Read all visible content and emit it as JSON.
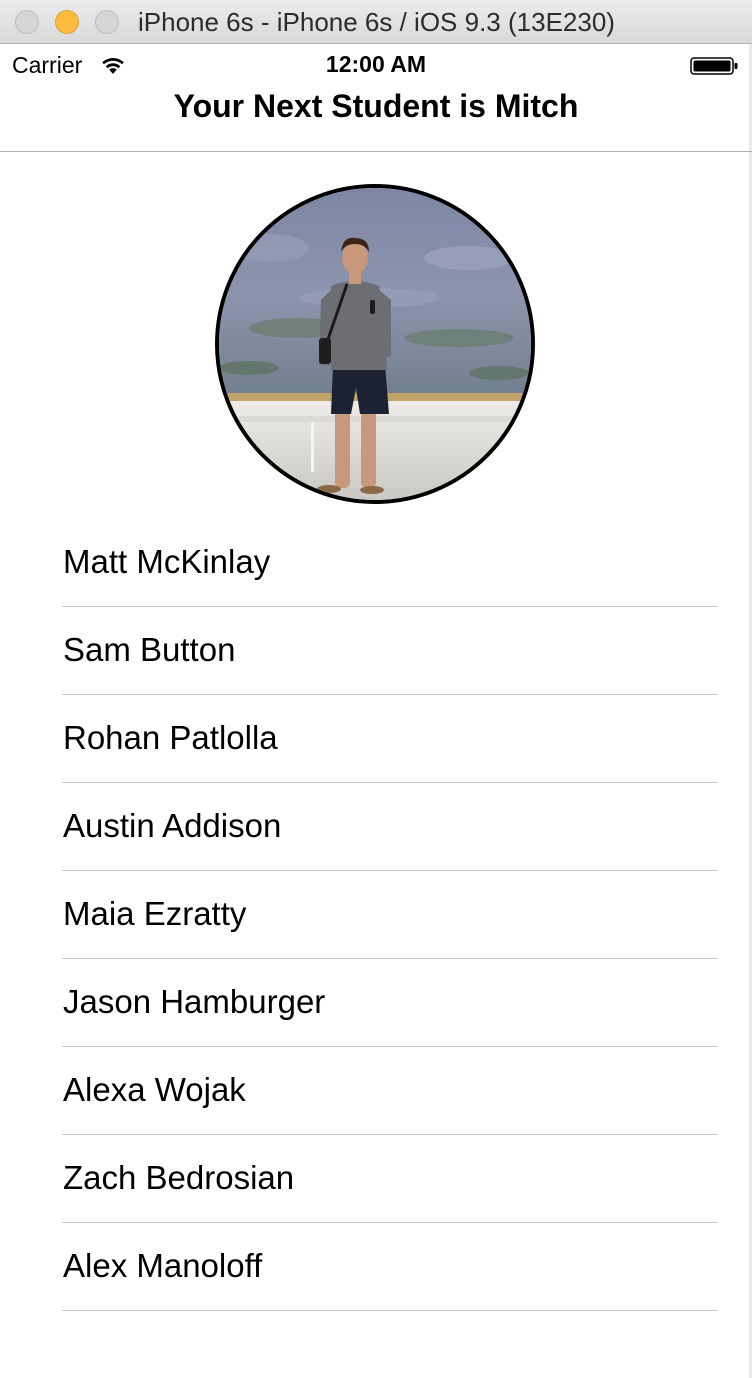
{
  "window": {
    "title": "iPhone 6s - iPhone 6s / iOS 9.3 (13E230)"
  },
  "status_bar": {
    "carrier": "Carrier",
    "time": "12:00 AM",
    "wifi_icon": "wifi-icon",
    "battery_icon": "battery-icon"
  },
  "nav": {
    "title": "Your Next Student is Mitch"
  },
  "avatar": {
    "icon": "student-photo",
    "border_color": "#000000"
  },
  "students": [
    {
      "name": "Matt McKinlay"
    },
    {
      "name": "Sam Button"
    },
    {
      "name": "Rohan Patlolla"
    },
    {
      "name": "Austin Addison"
    },
    {
      "name": "Maia Ezratty"
    },
    {
      "name": "Jason Hamburger"
    },
    {
      "name": "Alexa Wojak"
    },
    {
      "name": "Zach Bedrosian"
    },
    {
      "name": "Alex Manoloff"
    }
  ],
  "colors": {
    "separator": "#c8c7cc",
    "minimize_button": "#fdbc40"
  }
}
